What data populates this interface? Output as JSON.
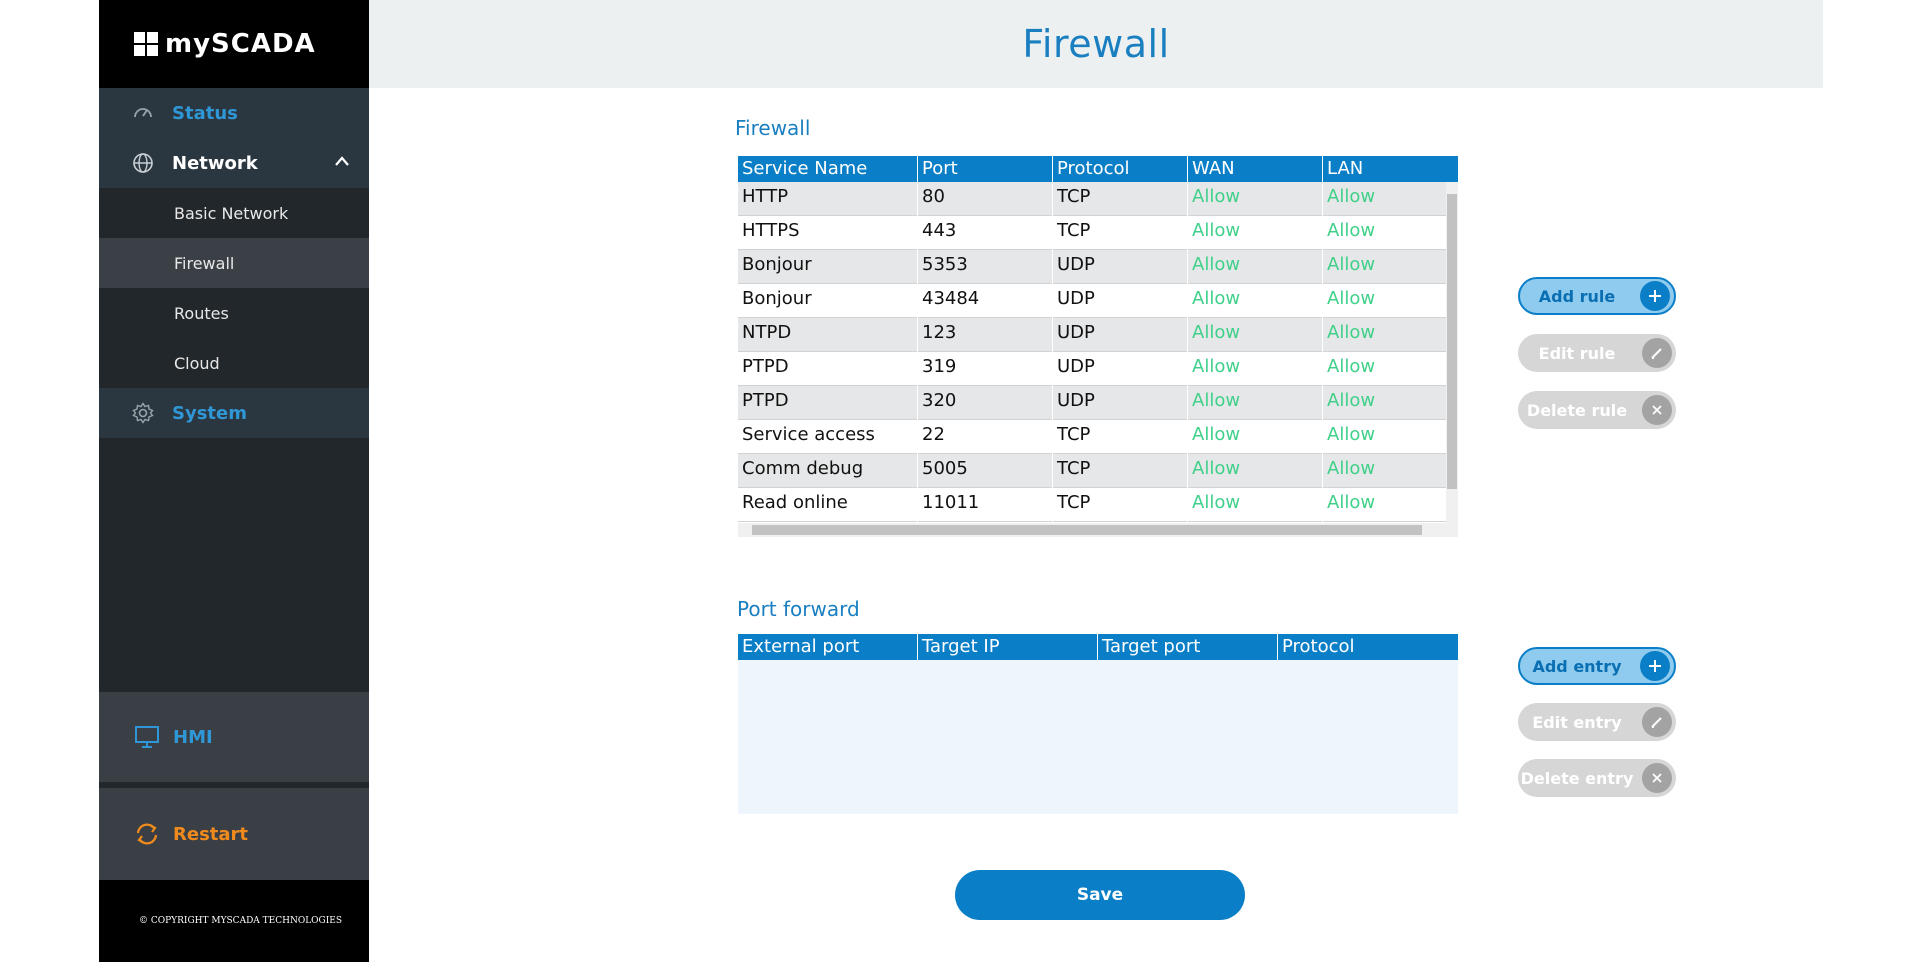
{
  "brand": {
    "name": "mySCADA"
  },
  "sidebar": {
    "status": "Status",
    "network": "Network",
    "network_items": [
      "Basic Network",
      "Firewall",
      "Routes",
      "Cloud"
    ],
    "system": "System",
    "hmi": "HMI",
    "restart": "Restart",
    "copyright": "© COPYRIGHT MYSCADA TECHNOLOGIES"
  },
  "header": {
    "title": "Firewall"
  },
  "firewall": {
    "title": "Firewall",
    "columns": [
      "Service Name",
      "Port",
      "Protocol",
      "WAN",
      "LAN"
    ],
    "rows": [
      [
        "HTTP",
        "80",
        "TCP",
        "Allow",
        "Allow"
      ],
      [
        "HTTPS",
        "443",
        "TCP",
        "Allow",
        "Allow"
      ],
      [
        "Bonjour",
        "5353",
        "UDP",
        "Allow",
        "Allow"
      ],
      [
        "Bonjour",
        "43484",
        "UDP",
        "Allow",
        "Allow"
      ],
      [
        "NTPD",
        "123",
        "UDP",
        "Allow",
        "Allow"
      ],
      [
        "PTPD",
        "319",
        "UDP",
        "Allow",
        "Allow"
      ],
      [
        "PTPD",
        "320",
        "UDP",
        "Allow",
        "Allow"
      ],
      [
        "Service access",
        "22",
        "TCP",
        "Allow",
        "Allow"
      ],
      [
        "Comm debug",
        "5005",
        "TCP",
        "Allow",
        "Allow"
      ],
      [
        "Read online",
        "11011",
        "TCP",
        "Allow",
        "Allow"
      ]
    ],
    "buttons": {
      "add": "Add rule",
      "edit": "Edit rule",
      "delete": "Delete rule"
    }
  },
  "port_forward": {
    "title": "Port forward",
    "columns": [
      "External port",
      "Target IP",
      "Target port",
      "Protocol"
    ],
    "buttons": {
      "add": "Add entry",
      "edit": "Edit entry",
      "delete": "Delete entry"
    }
  },
  "save_label": "Save",
  "colors": {
    "accent": "#0a7fc7",
    "allow": "#3fd08a",
    "restart": "#f08a1c",
    "sidebar": "#22272c"
  }
}
